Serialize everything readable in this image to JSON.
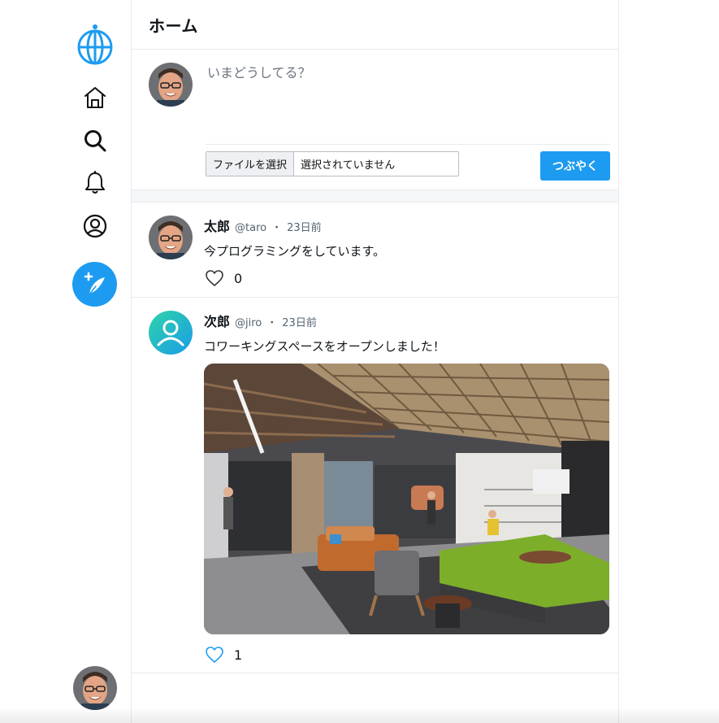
{
  "header": {
    "title": "ホーム"
  },
  "sidebar": {
    "items": [
      {
        "name": "logo",
        "icon": "globe-logo-icon"
      },
      {
        "name": "home",
        "icon": "home-icon"
      },
      {
        "name": "search",
        "icon": "search-icon"
      },
      {
        "name": "notifications",
        "icon": "bell-icon"
      },
      {
        "name": "profile",
        "icon": "user-circle-icon"
      }
    ],
    "compose_icon": "feather-plus-icon"
  },
  "composer": {
    "placeholder": "いまどうしてる？",
    "file_button": "ファイルを選択",
    "file_status": "選択されていません",
    "submit": "つぶやく"
  },
  "posts": [
    {
      "name": "太郎",
      "handle": "@taro",
      "dot": "・",
      "time": "23日前",
      "text": "今プログラミングをしています。",
      "likes": "0",
      "has_image": false
    },
    {
      "name": "次郎",
      "handle": "@jiro",
      "dot": "・",
      "time": "23日前",
      "text": "コワーキングスペースをオープンしました！",
      "likes": "1",
      "has_image": true
    }
  ],
  "colors": {
    "accent": "#1d9bf0",
    "border": "#e6ecf0"
  }
}
